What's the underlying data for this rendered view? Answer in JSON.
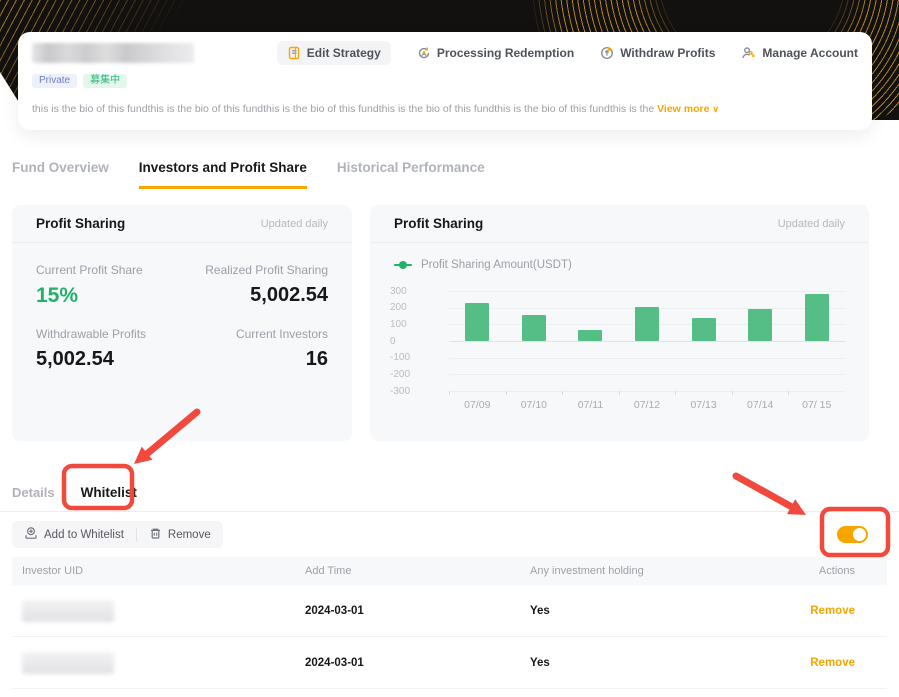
{
  "colors": {
    "accent_orange": "#f7a600",
    "positive_green": "#20b26b",
    "bar_green": "#55bd86",
    "annotation_red": "#f2493e",
    "banner_black": "#121110",
    "banner_gold": "#c89632",
    "card_bg": "#f7f8fa"
  },
  "header": {
    "badges": [
      {
        "label": "Private"
      },
      {
        "label": "募集中"
      }
    ],
    "actions": [
      {
        "label": "Edit Strategy",
        "icon": "edit-strategy-icon",
        "highlighted": true
      },
      {
        "label": "Processing Redemption",
        "icon": "processing-redemption-icon",
        "highlighted": false
      },
      {
        "label": "Withdraw Profits",
        "icon": "withdraw-profits-icon",
        "highlighted": false
      },
      {
        "label": "Manage Account",
        "icon": "manage-account-icon",
        "highlighted": false
      }
    ],
    "bio_text": "this is the bio of this fundthis is the bio of this fundthis is the bio of this fundthis is the bio of this fundthis is the bio of this fundthis is the ",
    "view_more_label": "View more",
    "view_more_chevron": "∨"
  },
  "main_tabs": [
    {
      "label": "Fund Overview",
      "active": false
    },
    {
      "label": "Investors and Profit Share",
      "active": true
    },
    {
      "label": "Historical Performance",
      "active": false
    }
  ],
  "profit_summary": {
    "title": "Profit Sharing",
    "updated": "Updated daily",
    "stats": [
      {
        "label": "Current Profit Share",
        "value": "15%",
        "emphasis": "green"
      },
      {
        "label": "Realized Profit Sharing",
        "value": "5,002.54",
        "emphasis": "dark"
      },
      {
        "label": "Withdrawable Profits",
        "value": "5,002.54",
        "emphasis": "dark"
      },
      {
        "label": "Current Investors",
        "value": "16",
        "emphasis": "dark"
      }
    ]
  },
  "chart_card": {
    "title": "Profit Sharing",
    "updated": "Updated daily"
  },
  "chart_data": {
    "type": "bar",
    "title": "Profit Sharing",
    "legend": [
      "Profit Sharing Amount(USDT)"
    ],
    "legend_position": "top-left",
    "categories": [
      "07/09",
      "07/10",
      "07/11",
      "07/12",
      "07/13",
      "07/14",
      "07/ 15"
    ],
    "values": [
      230,
      155,
      65,
      205,
      140,
      195,
      280
    ],
    "ylim": [
      -300,
      300
    ],
    "yticks": [
      300,
      200,
      100,
      0,
      -100,
      -200,
      -300
    ],
    "grid": true,
    "bar_color": "#55bd86"
  },
  "whitelist_section": {
    "tabs": [
      {
        "label": "Details",
        "active": false
      },
      {
        "label": "Whitelist",
        "active": true
      }
    ],
    "toolbar": [
      {
        "label": "Add to Whitelist",
        "icon": "add-to-whitelist-icon"
      },
      {
        "label": "Remove",
        "icon": "trash-icon"
      }
    ],
    "toggle_on": true
  },
  "table": {
    "columns": [
      "Investor UID",
      "Add Time",
      "Any investment holding",
      "Actions"
    ],
    "rows": [
      {
        "uid_redacted": true,
        "add_time": "2024-03-01",
        "holding": "Yes",
        "action": "Remove"
      },
      {
        "uid_redacted": true,
        "add_time": "2024-03-01",
        "holding": "Yes",
        "action": "Remove"
      }
    ]
  },
  "annotations": {
    "color": "#f2493e",
    "highlighted_elements": [
      "whitelist-tab",
      "whitelist-visibility-toggle"
    ]
  }
}
